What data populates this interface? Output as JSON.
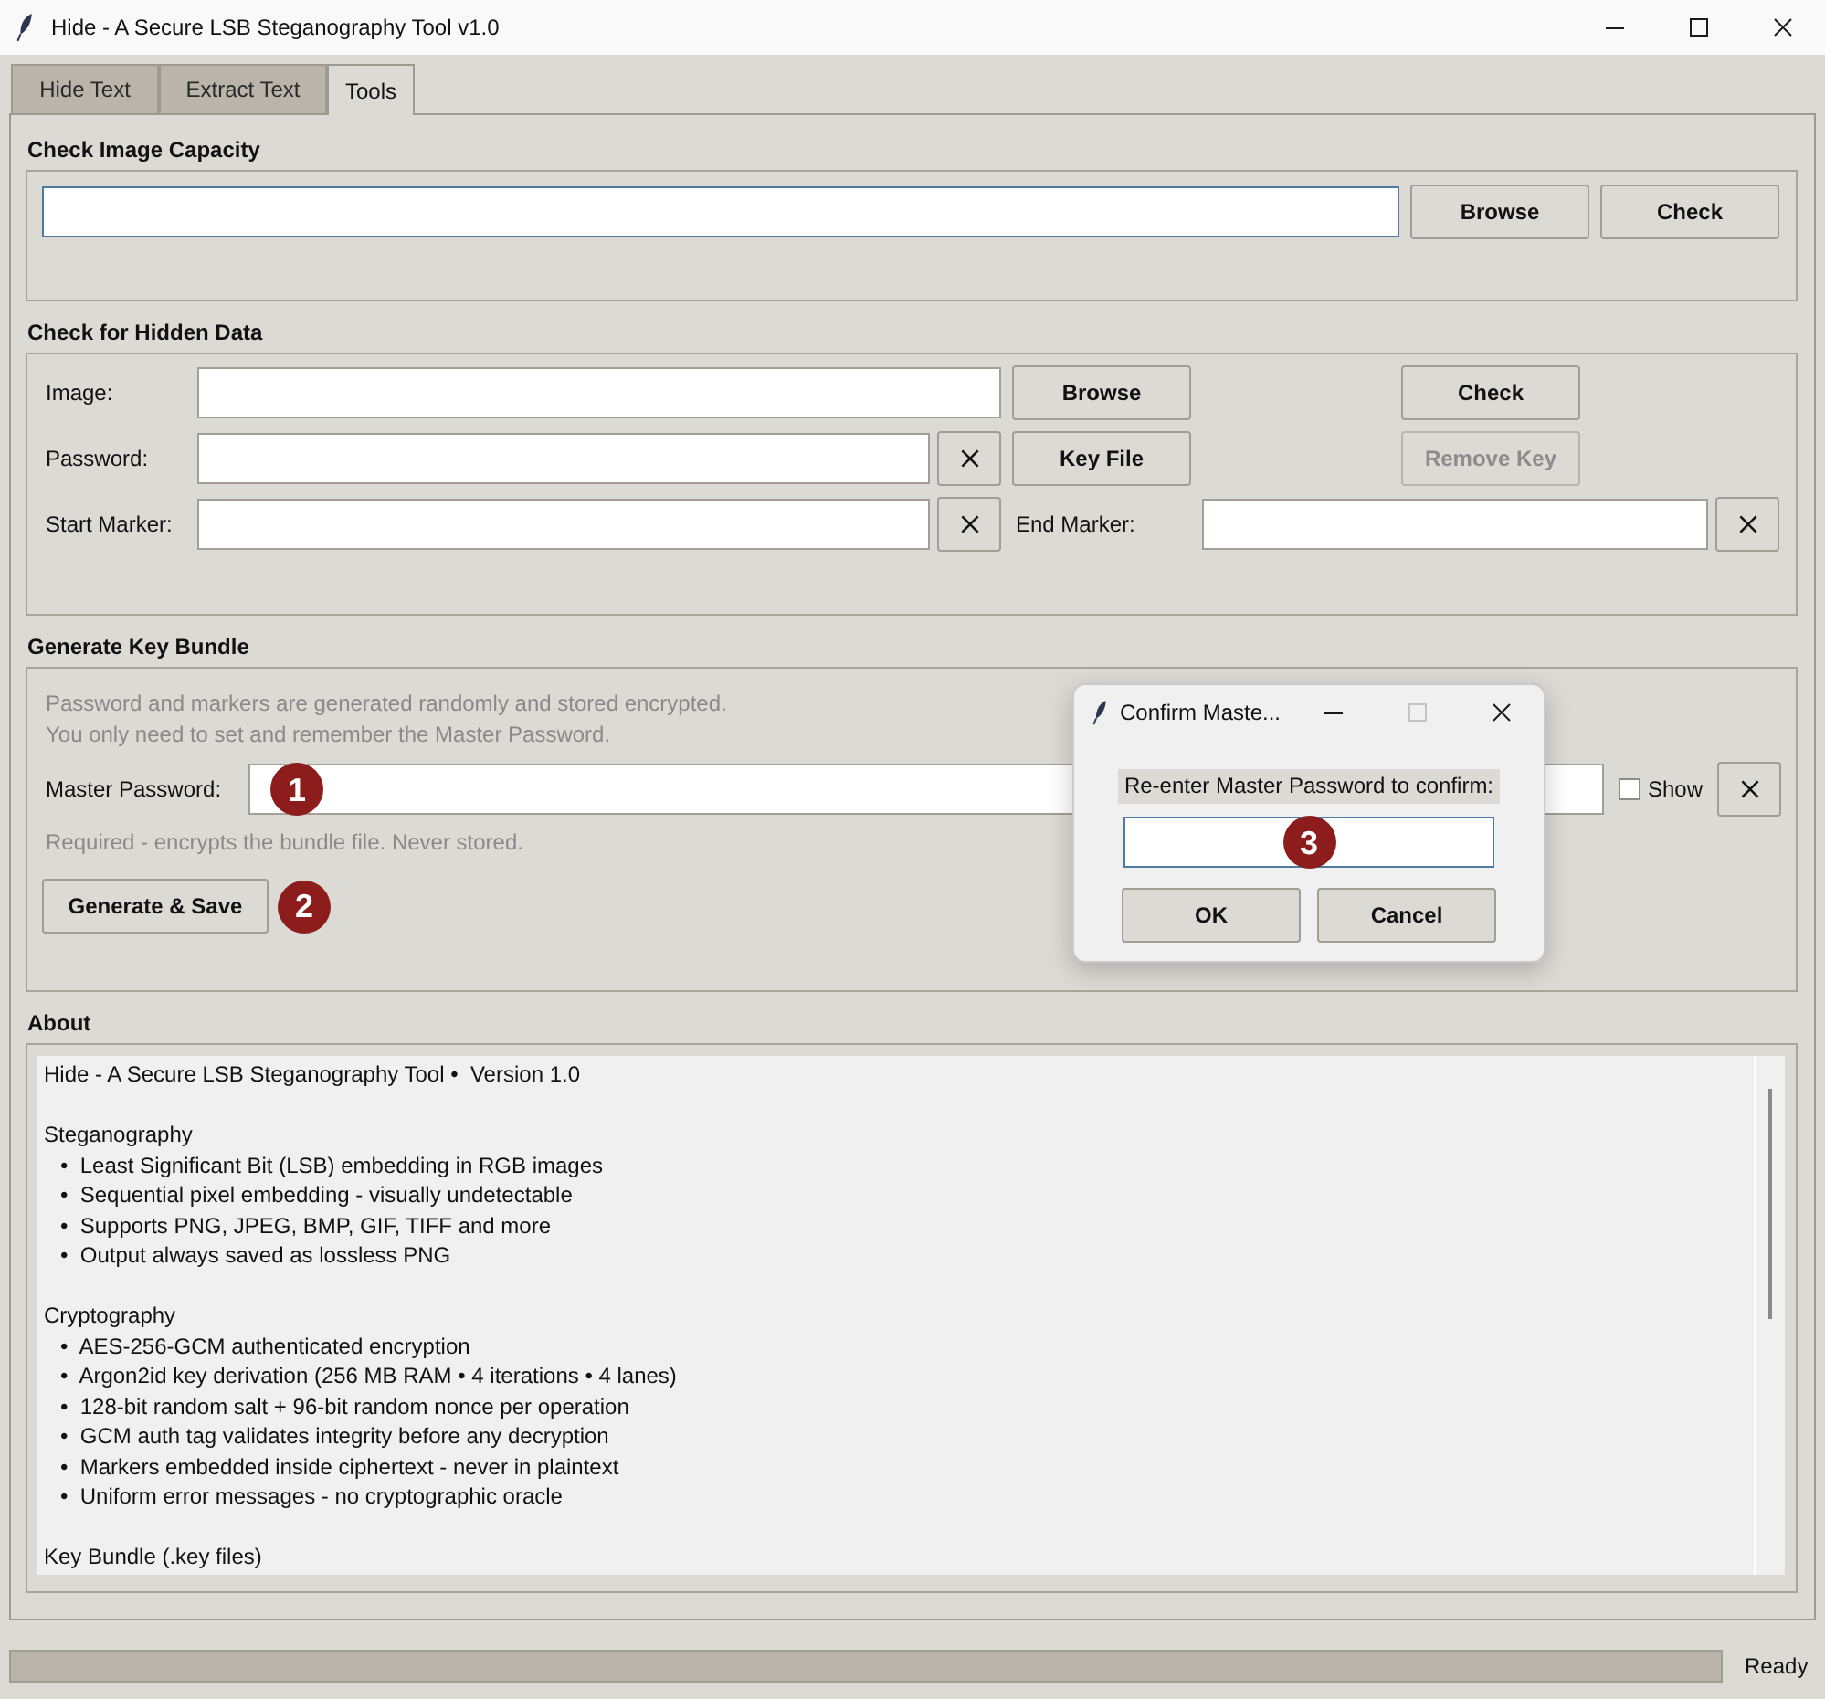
{
  "window": {
    "title": "Hide - A Secure LSB Steganography Tool v1.0"
  },
  "tabs": [
    {
      "label": "Hide Text",
      "selected": false
    },
    {
      "label": "Extract Text",
      "selected": false
    },
    {
      "label": "Tools",
      "selected": true
    }
  ],
  "capacity": {
    "title": "Check Image Capacity",
    "path_field": {
      "focused": true
    },
    "browse_button": {
      "label": "Browse",
      "disabled": false
    },
    "check_button": {
      "label": "Check",
      "disabled": false
    }
  },
  "hidden_data": {
    "title": "Check for Hidden Data",
    "image_field": {
      "label": "Image:",
      "focused": false
    },
    "password_field": {
      "label": "Password:",
      "focused": false
    },
    "start_marker_field": {
      "label": "Start Marker:",
      "focused": false
    },
    "end_marker_field": {
      "label": "End Marker:",
      "focused": false
    },
    "browse_button": {
      "label": "Browse",
      "disabled": false
    },
    "key_file_button": {
      "label": "Key File",
      "disabled": false
    },
    "check_button": {
      "label": "Check",
      "disabled": false
    },
    "remove_key_button": {
      "label": "Remove Key",
      "disabled": true
    }
  },
  "key_bundle": {
    "title": "Generate Key Bundle",
    "info_lines": [
      "Password and markers are generated randomly and stored encrypted.",
      "You only need to set and remember the Master Password."
    ],
    "master_password_field": {
      "label": "Master Password:",
      "focused": false,
      "callout": "1"
    },
    "show_checkbox": {
      "label": "Show",
      "checked": false
    },
    "hint": "Required - encrypts the bundle file. Never stored.",
    "generate_button": {
      "label": "Generate & Save",
      "disabled": false,
      "callout": "2"
    }
  },
  "about": {
    "title": "About",
    "intro": "Hide - A Secure LSB Steganography Tool •  Version 1.0",
    "sections": [
      {
        "heading": "Steganography",
        "bullets": [
          "•  Least Significant Bit (LSB) embedding in RGB images",
          "•  Sequential pixel embedding - visually undetectable",
          "•  Supports PNG, JPEG, BMP, GIF, TIFF and more",
          "•  Output always saved as lossless PNG"
        ]
      },
      {
        "heading": "Cryptography",
        "bullets": [
          "•  AES-256-GCM authenticated encryption",
          "•  Argon2id key derivation (256 MB RAM • 4 iterations • 4 lanes)",
          "•  128-bit random salt + 96-bit random nonce per operation",
          "•  GCM auth tag validates integrity before any decryption",
          "•  Markers embedded inside ciphertext - never in plaintext",
          "•  Uniform error messages - no cryptographic oracle"
        ]
      },
      {
        "heading": "Key Bundle (.key files)"
      }
    ]
  },
  "dialog": {
    "title": "Confirm Maste...",
    "prompt": "Re-enter Master Password to confirm:",
    "field": {
      "focused": true,
      "callout": "3"
    },
    "ok_button": {
      "label": "OK",
      "disabled": false
    },
    "cancel_button": {
      "label": "Cancel",
      "disabled": false
    }
  },
  "status_bar": {
    "text": "Ready"
  }
}
